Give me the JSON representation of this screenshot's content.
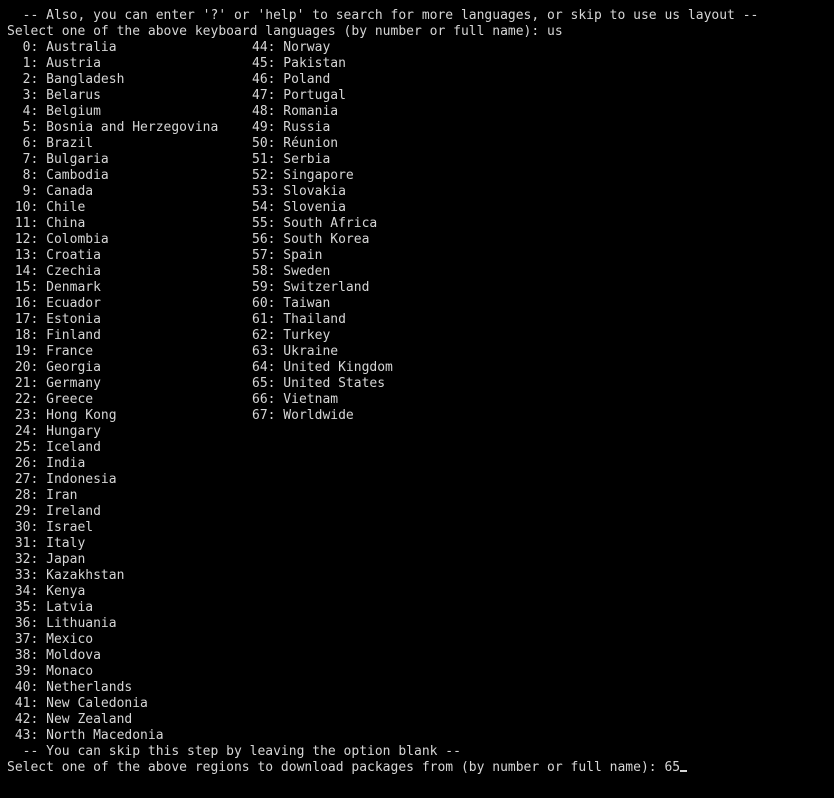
{
  "terminal": {
    "background_color": "#000000",
    "text_color": "#d6d6d6",
    "keyboard_hint": "  -- Also, you can enter '?' or 'help' to search for more languages, or skip to use us layout --",
    "keyboard_prompt": "Select one of the above keyboard languages (by number or full name): us",
    "region_hint": "  -- You can skip this step by leaving the option blank --",
    "region_prompt": "Select one of the above regions to download packages from (by number or full name): ",
    "region_input": "65",
    "cursor": "_"
  },
  "regions": {
    "left_column": [
      {
        "num": "0",
        "name": "Australia"
      },
      {
        "num": "1",
        "name": "Austria"
      },
      {
        "num": "2",
        "name": "Bangladesh"
      },
      {
        "num": "3",
        "name": "Belarus"
      },
      {
        "num": "4",
        "name": "Belgium"
      },
      {
        "num": "5",
        "name": "Bosnia and Herzegovina"
      },
      {
        "num": "6",
        "name": "Brazil"
      },
      {
        "num": "7",
        "name": "Bulgaria"
      },
      {
        "num": "8",
        "name": "Cambodia"
      },
      {
        "num": "9",
        "name": "Canada"
      },
      {
        "num": "10",
        "name": "Chile"
      },
      {
        "num": "11",
        "name": "China"
      },
      {
        "num": "12",
        "name": "Colombia"
      },
      {
        "num": "13",
        "name": "Croatia"
      },
      {
        "num": "14",
        "name": "Czechia"
      },
      {
        "num": "15",
        "name": "Denmark"
      },
      {
        "num": "16",
        "name": "Ecuador"
      },
      {
        "num": "17",
        "name": "Estonia"
      },
      {
        "num": "18",
        "name": "Finland"
      },
      {
        "num": "19",
        "name": "France"
      },
      {
        "num": "20",
        "name": "Georgia"
      },
      {
        "num": "21",
        "name": "Germany"
      },
      {
        "num": "22",
        "name": "Greece"
      },
      {
        "num": "23",
        "name": "Hong Kong"
      },
      {
        "num": "24",
        "name": "Hungary"
      },
      {
        "num": "25",
        "name": "Iceland"
      },
      {
        "num": "26",
        "name": "India"
      },
      {
        "num": "27",
        "name": "Indonesia"
      },
      {
        "num": "28",
        "name": "Iran"
      },
      {
        "num": "29",
        "name": "Ireland"
      },
      {
        "num": "30",
        "name": "Israel"
      },
      {
        "num": "31",
        "name": "Italy"
      },
      {
        "num": "32",
        "name": "Japan"
      },
      {
        "num": "33",
        "name": "Kazakhstan"
      },
      {
        "num": "34",
        "name": "Kenya"
      },
      {
        "num": "35",
        "name": "Latvia"
      },
      {
        "num": "36",
        "name": "Lithuania"
      },
      {
        "num": "37",
        "name": "Mexico"
      },
      {
        "num": "38",
        "name": "Moldova"
      },
      {
        "num": "39",
        "name": "Monaco"
      },
      {
        "num": "40",
        "name": "Netherlands"
      },
      {
        "num": "41",
        "name": "New Caledonia"
      },
      {
        "num": "42",
        "name": "New Zealand"
      },
      {
        "num": "43",
        "name": "North Macedonia"
      }
    ],
    "right_column": [
      {
        "num": "44",
        "name": "Norway"
      },
      {
        "num": "45",
        "name": "Pakistan"
      },
      {
        "num": "46",
        "name": "Poland"
      },
      {
        "num": "47",
        "name": "Portugal"
      },
      {
        "num": "48",
        "name": "Romania"
      },
      {
        "num": "49",
        "name": "Russia"
      },
      {
        "num": "50",
        "name": "Réunion"
      },
      {
        "num": "51",
        "name": "Serbia"
      },
      {
        "num": "52",
        "name": "Singapore"
      },
      {
        "num": "53",
        "name": "Slovakia"
      },
      {
        "num": "54",
        "name": "Slovenia"
      },
      {
        "num": "55",
        "name": "South Africa"
      },
      {
        "num": "56",
        "name": "South Korea"
      },
      {
        "num": "57",
        "name": "Spain"
      },
      {
        "num": "58",
        "name": "Sweden"
      },
      {
        "num": "59",
        "name": "Switzerland"
      },
      {
        "num": "60",
        "name": "Taiwan"
      },
      {
        "num": "61",
        "name": "Thailand"
      },
      {
        "num": "62",
        "name": "Turkey"
      },
      {
        "num": "63",
        "name": "Ukraine"
      },
      {
        "num": "64",
        "name": "United Kingdom"
      },
      {
        "num": "65",
        "name": "United States"
      },
      {
        "num": "66",
        "name": "Vietnam"
      },
      {
        "num": "67",
        "name": "Worldwide"
      }
    ]
  }
}
